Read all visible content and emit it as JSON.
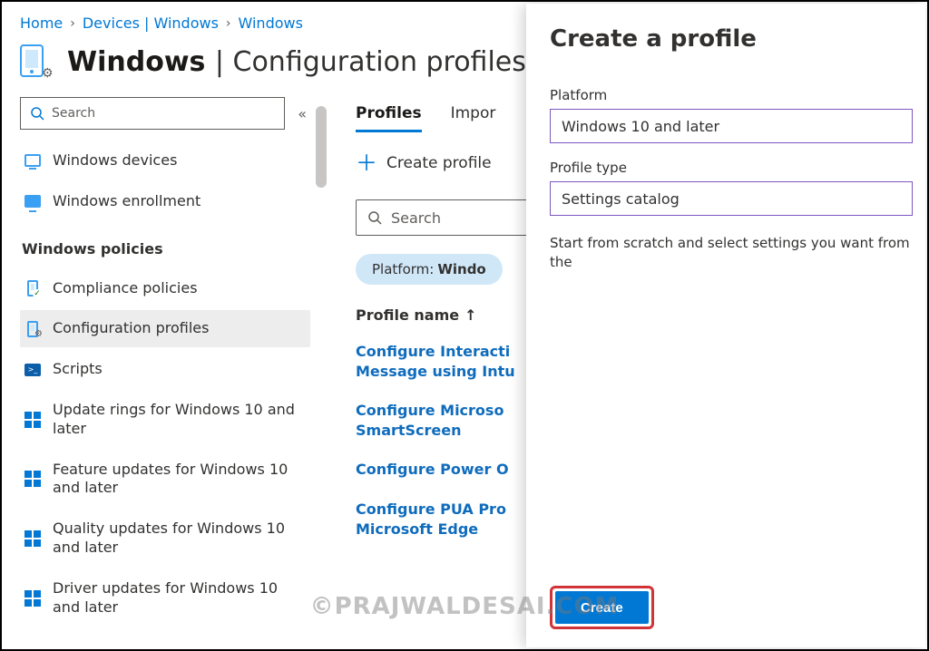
{
  "breadcrumbs": {
    "home": "Home",
    "devices": "Devices | Windows",
    "windows": "Windows"
  },
  "page_title": {
    "main": "Windows",
    "sub": "Configuration profiles"
  },
  "sidebar": {
    "search_placeholder": "Search",
    "items_top": [
      {
        "label": "Windows devices"
      },
      {
        "label": "Windows enrollment"
      }
    ],
    "policies_header": "Windows policies",
    "items": [
      {
        "label": "Compliance policies"
      },
      {
        "label": "Configuration profiles"
      },
      {
        "label": "Scripts"
      },
      {
        "label": "Update rings for Windows 10 and later"
      },
      {
        "label": "Feature updates for Windows 10 and later"
      },
      {
        "label": "Quality updates for Windows 10 and later"
      },
      {
        "label": "Driver updates for Windows 10 and later"
      }
    ]
  },
  "main": {
    "tabs": {
      "profiles": "Profiles",
      "import": "Impor"
    },
    "create_profile": "Create profile",
    "search_placeholder": "Search",
    "filter_chip": {
      "label": "Platform:",
      "value": "Windo"
    },
    "column_header": "Profile name",
    "rows": [
      "Configure Interacti Message using Intu",
      "Configure Microso SmartScreen",
      "Configure Power O",
      "Configure PUA Pro Microsoft Edge"
    ]
  },
  "panel": {
    "title": "Create a profile",
    "platform_label": "Platform",
    "platform_value": "Windows 10 and later",
    "profile_type_label": "Profile type",
    "profile_type_value": "Settings catalog",
    "helper_text": "Start from scratch and select settings you want from the",
    "create_button": "Create"
  },
  "watermark": "©PRAJWALDESAI.COM"
}
